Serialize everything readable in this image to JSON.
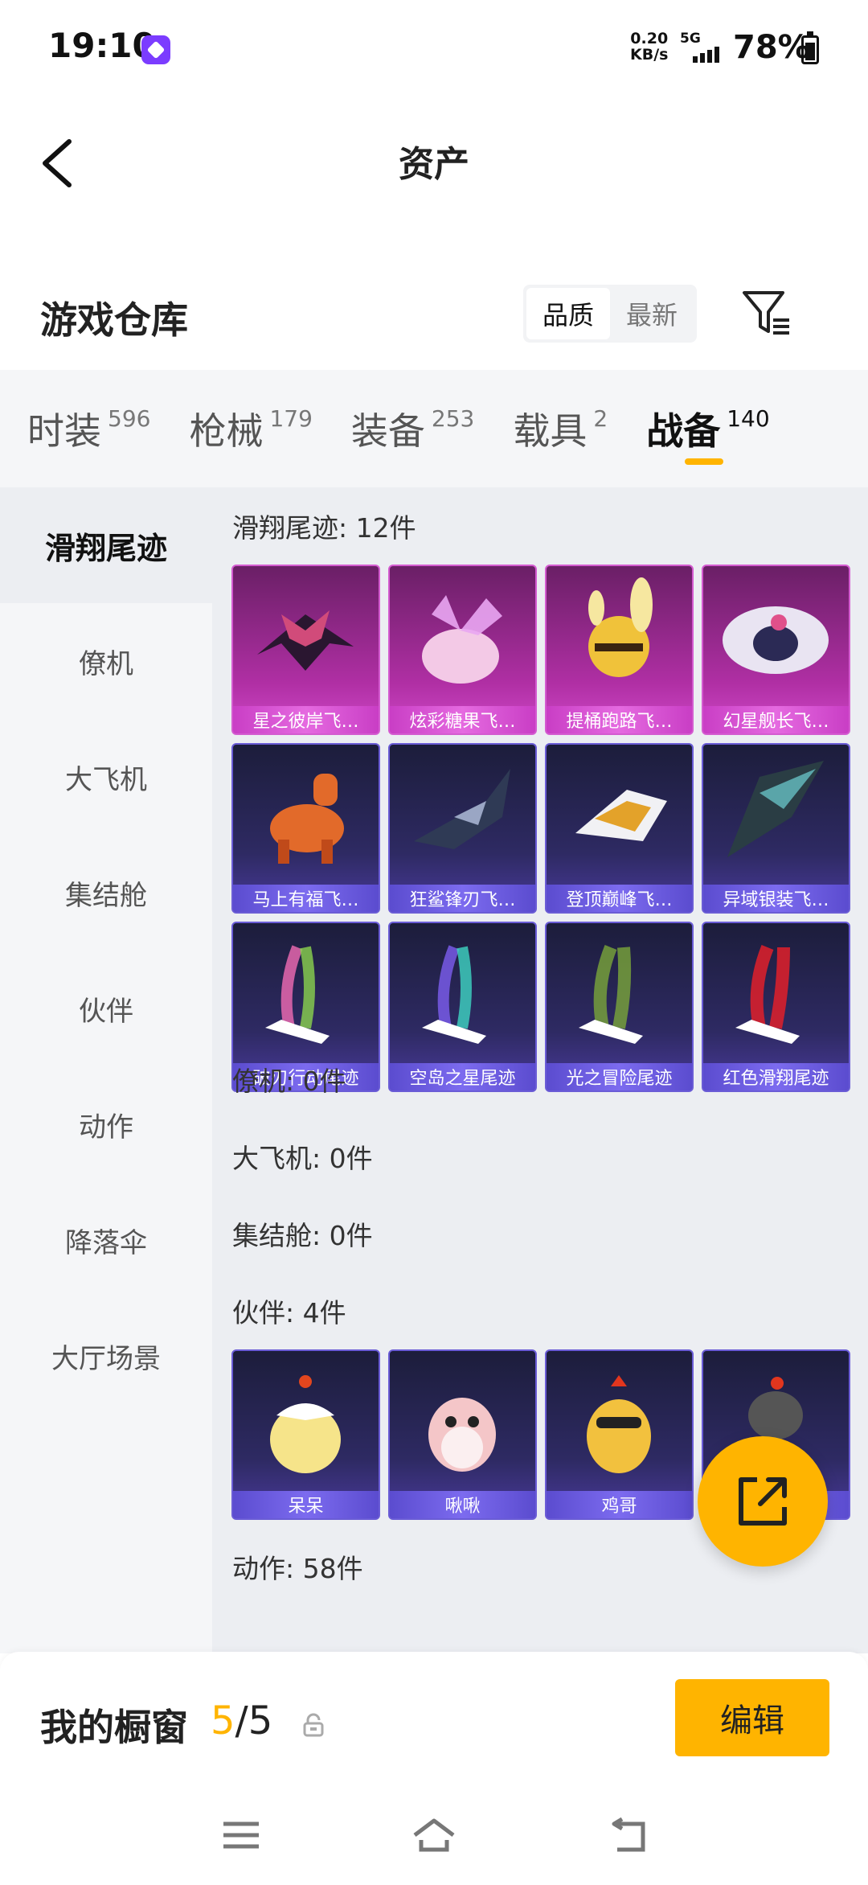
{
  "status_bar": {
    "time": "19:10",
    "net_speed_value": "0.20",
    "net_speed_unit": "KB/s",
    "network_type": "5G",
    "battery": "78%"
  },
  "header": {
    "title": "资产",
    "back_icon": "chevron-left-icon"
  },
  "warehouse": {
    "title": "游戏仓库",
    "sort_options": [
      "品质",
      "最新"
    ],
    "selected_sort": "品质",
    "filter_icon": "filter-icon"
  },
  "tabs": [
    {
      "label": "时装",
      "count": "596"
    },
    {
      "label": "枪械",
      "count": "179"
    },
    {
      "label": "装备",
      "count": "253"
    },
    {
      "label": "载具",
      "count": "2"
    },
    {
      "label": "战备",
      "count": "140"
    }
  ],
  "active_tab": "战备",
  "side_nav": [
    "滑翔尾迹",
    "僚机",
    "大飞机",
    "集结舱",
    "伙伴",
    "动作",
    "降落伞",
    "大厅场景"
  ],
  "active_side_nav": "滑翔尾迹",
  "sections": {
    "trail": {
      "title": "滑翔尾迹: 12件",
      "items": [
        "星之彼岸飞…",
        "炫彩糖果飞…",
        "提桶跑路飞…",
        "幻星舰长飞…",
        "马上有福飞…",
        "狂鲨锋刃飞…",
        "登顶巅峰飞…",
        "异域银装飞…",
        "破刃行动尾迹",
        "空岛之星尾迹",
        "光之冒险尾迹",
        "红色滑翔尾迹"
      ]
    },
    "wingman": {
      "title": "僚机: 0件"
    },
    "big_plane": {
      "title": "大飞机: 0件"
    },
    "cabin": {
      "title": "集结舱: 0件"
    },
    "companion": {
      "title": "伙伴: 4件",
      "items": [
        "呆呆",
        "啾啾",
        "鸡哥",
        ""
      ]
    },
    "action": {
      "title": "动作: 58件"
    }
  },
  "showcase": {
    "label": "我的橱窗",
    "current": "5",
    "separator": "/",
    "total": "5",
    "edit_label": "编辑"
  },
  "colors": {
    "accent": "#ffb400",
    "rare_pink": "#c93ec5",
    "rare_purple": "#5b4ccf"
  }
}
